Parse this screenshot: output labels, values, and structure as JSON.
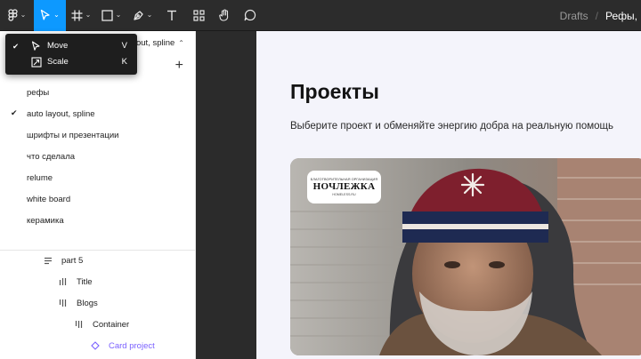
{
  "toolbar": {
    "breadcrumb": {
      "drafts": "Drafts",
      "separator": "/",
      "file": "Рефы,"
    }
  },
  "tool_menu": {
    "items": [
      {
        "label": "Move",
        "shortcut": "V",
        "checked": true
      },
      {
        "label": "Scale",
        "shortcut": "K",
        "checked": false
      }
    ]
  },
  "left_panel": {
    "current_page": "auto layout, spline",
    "pages": [
      {
        "label": "рефы",
        "checked": false
      },
      {
        "label": "auto layout, spline",
        "checked": true
      },
      {
        "label": "шрифты и презентации",
        "checked": false
      },
      {
        "label": "что сделала",
        "checked": false
      },
      {
        "label": "relume",
        "checked": false
      },
      {
        "label": "white board",
        "checked": false
      },
      {
        "label": "керамика",
        "checked": false
      }
    ],
    "layers": [
      {
        "label": "part 5",
        "icon": "vertical-auto-layout-icon"
      },
      {
        "label": "Title",
        "icon": "horizontal-auto-layout-icon"
      },
      {
        "label": "Blogs",
        "icon": "horizontal-auto-layout-icon"
      },
      {
        "label": "Container",
        "icon": "horizontal-auto-layout-icon"
      },
      {
        "label": "Card project",
        "icon": "component-instance-icon"
      }
    ]
  },
  "canvas": {
    "title": "Проекты",
    "subtitle": "Выберите проект и обменяйте энергию добра на реальную помощь",
    "card": {
      "logo_small": "БЛАГОТВОРИТЕЛЬНАЯ ОРГАНИЗАЦИЯ",
      "logo_main": "НОЧЛЕЖКА",
      "logo_url": "HOMELESS.RU"
    }
  },
  "colors": {
    "toolbar_bg": "#2c2c2c",
    "accent": "#0d99ff",
    "component": "#7b61ff",
    "frame_bg": "#f4f4fb"
  }
}
